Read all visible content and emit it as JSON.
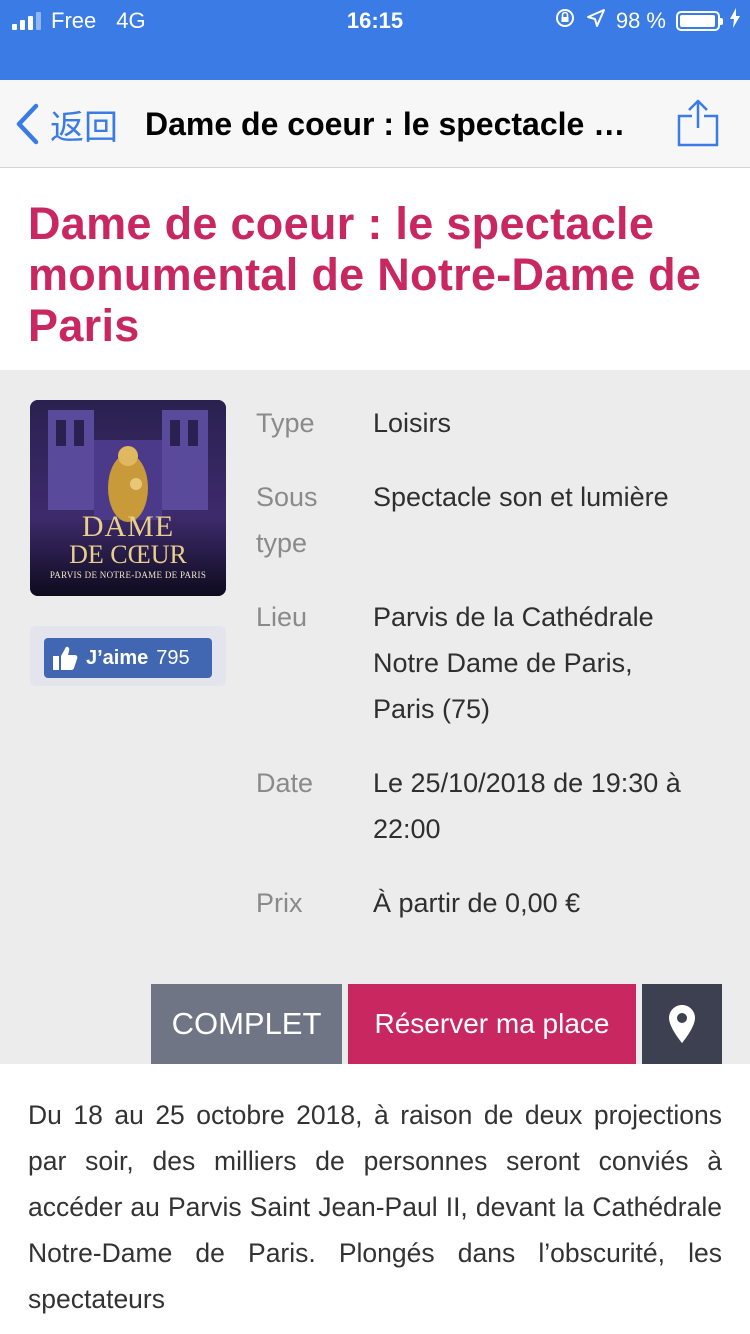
{
  "status_bar": {
    "carrier": "Free",
    "network": "4G",
    "time": "16:15",
    "battery": "98 %",
    "battery_level": 0.98,
    "icons": [
      "signal-icon",
      "orientation-lock-icon",
      "location-icon",
      "battery-icon",
      "charging-icon"
    ]
  },
  "nav": {
    "back_label": "返回",
    "title": "Dame de coeur : le spectacle monumental de Notre-Dame de Paris",
    "icons": [
      "chevron-left-icon",
      "share-icon"
    ]
  },
  "headline": "Dame de coeur : le spectacle monumental de Notre-Dame de Paris",
  "poster": {
    "title_line1": "DAME",
    "title_line2": "DE CŒUR",
    "subtitle": "PARVIS DE NOTRE-DAME DE PARIS"
  },
  "like": {
    "label": "J’aime",
    "count": "795",
    "icon": "thumbs-up-icon"
  },
  "details": [
    {
      "key": "Type",
      "value": "Loisirs"
    },
    {
      "key": "Sous type",
      "value": "Spectacle son et lumière"
    },
    {
      "key": "Lieu",
      "value": "Parvis de la Cathédrale Notre Dame de Paris, Paris (75)"
    },
    {
      "key": "Date",
      "value": "Le 25/10/2018 de 19:30 à 22:00"
    },
    {
      "key": "Prix",
      "value": "À partir de 0,00 €"
    }
  ],
  "actions": {
    "complet": "COMPLET",
    "reserve": "Réserver ma place",
    "map_icon": "map-pin-icon"
  },
  "colors": {
    "status_bar": "#3a7be6",
    "accent": "#c8285f",
    "complet_button": "#6f7585",
    "map_button": "#3d4050",
    "facebook": "#4267b2",
    "info_bg": "#ececec"
  },
  "description": "Du 18 au 25 octobre 2018, à raison de deux projections par soir, des milliers de personnes seront conviés à accéder au Parvis Saint Jean-Paul II, devant la Cathédrale Notre-Dame de Paris. Plongés dans l’obscurité, les spectateurs"
}
